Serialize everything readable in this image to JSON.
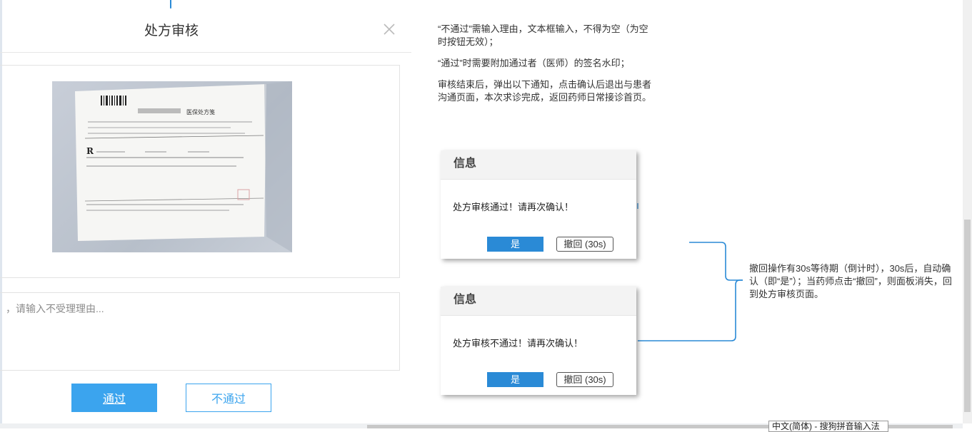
{
  "dialog": {
    "title": "处方审核",
    "reason_placeholder": "，请输入不受理理由...",
    "pass_label": "通过",
    "reject_label": "不通过"
  },
  "prescription_photo": {
    "header": "医保处方笺",
    "rx_symbol": "R"
  },
  "notes": {
    "note1": "“不通过”需输入理由，文本框输入，不得为空（为空时按钮无效）；",
    "note2": "“通过”时需要附加通过者（医师）的签名水印；",
    "note3": "审核结束后，弹出以下通知，点击确认后退出与患者沟通页面，本次求诊完成，返回药师日常接诊首页。"
  },
  "popup_pass": {
    "title": "信息",
    "message": "处方审核通过！请再次确认！",
    "yes_label": "是",
    "undo_label": "撤回 (30s)"
  },
  "popup_reject": {
    "title": "信息",
    "message": "处方审核不通过！请再次确认！",
    "yes_label": "是",
    "undo_label": "撤回 (30s)"
  },
  "side_note": "撤回操作有30s等待期（倒计时），30s后，自动确认（即“是”）；当药师点击“撤回”，则面板消失，回到处方审核页面。",
  "ime": "中文(简体) - 搜狗拼音输入法",
  "colors": {
    "accent": "#3ba4ee",
    "connector": "#2a8ad6"
  }
}
